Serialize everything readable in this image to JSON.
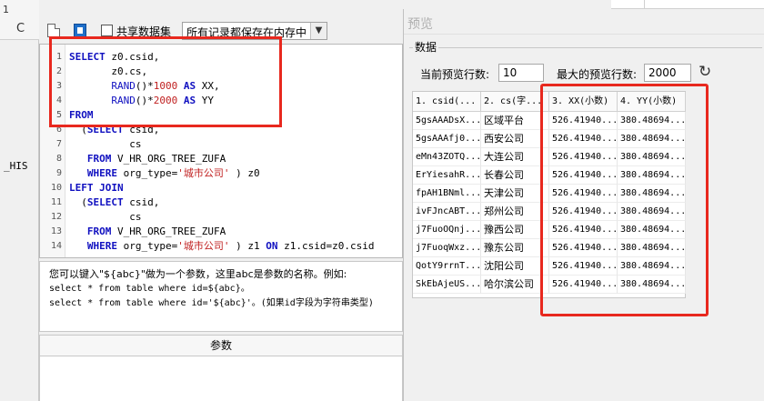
{
  "left_panel": {
    "top_text": "1",
    "side_label": "_HIS",
    "refresh_glyph": "C"
  },
  "toolbar": {
    "share_label": "共享数据集",
    "memory_select_value": "所有记录都保存在内存中",
    "file_icon": "file-icon",
    "db_icon": "database-icon"
  },
  "editor": {
    "lines": [
      {
        "n": "1",
        "segments": [
          {
            "t": "SELECT",
            "c": "kw"
          },
          {
            "t": " z0.csid,",
            "c": ""
          }
        ]
      },
      {
        "n": "2",
        "segments": [
          {
            "t": "       z0.cs,",
            "c": ""
          }
        ]
      },
      {
        "n": "3",
        "segments": [
          {
            "t": "       ",
            "c": ""
          },
          {
            "t": "RAND",
            "c": "fn"
          },
          {
            "t": "()*",
            "c": ""
          },
          {
            "t": "1000",
            "c": "num"
          },
          {
            "t": " ",
            "c": ""
          },
          {
            "t": "AS",
            "c": "kw"
          },
          {
            "t": " XX,",
            "c": ""
          }
        ]
      },
      {
        "n": "4",
        "segments": [
          {
            "t": "       ",
            "c": ""
          },
          {
            "t": "RAND",
            "c": "fn"
          },
          {
            "t": "()*",
            "c": ""
          },
          {
            "t": "2000",
            "c": "num"
          },
          {
            "t": " ",
            "c": ""
          },
          {
            "t": "AS",
            "c": "kw"
          },
          {
            "t": " YY",
            "c": ""
          }
        ]
      },
      {
        "n": "5",
        "segments": [
          {
            "t": "FROM",
            "c": "kw"
          }
        ]
      },
      {
        "n": "6",
        "segments": [
          {
            "t": "  (",
            "c": ""
          },
          {
            "t": "SELECT",
            "c": "kw"
          },
          {
            "t": " csid,",
            "c": ""
          }
        ]
      },
      {
        "n": "7",
        "segments": [
          {
            "t": "          cs",
            "c": ""
          }
        ]
      },
      {
        "n": "8",
        "segments": [
          {
            "t": "   ",
            "c": ""
          },
          {
            "t": "FROM",
            "c": "kw"
          },
          {
            "t": " V_HR_ORG_TREE_ZUFA",
            "c": ""
          }
        ]
      },
      {
        "n": "9",
        "segments": [
          {
            "t": "   ",
            "c": ""
          },
          {
            "t": "WHERE",
            "c": "kw"
          },
          {
            "t": " org_type=",
            "c": ""
          },
          {
            "t": "'城市公司'",
            "c": "str"
          },
          {
            "t": " ) z0",
            "c": ""
          }
        ]
      },
      {
        "n": "10",
        "segments": [
          {
            "t": "LEFT JOIN",
            "c": "kw"
          }
        ]
      },
      {
        "n": "11",
        "segments": [
          {
            "t": "  (",
            "c": ""
          },
          {
            "t": "SELECT",
            "c": "kw"
          },
          {
            "t": " csid,",
            "c": ""
          }
        ]
      },
      {
        "n": "12",
        "segments": [
          {
            "t": "          cs",
            "c": ""
          }
        ]
      },
      {
        "n": "13",
        "segments": [
          {
            "t": "   ",
            "c": ""
          },
          {
            "t": "FROM",
            "c": "kw"
          },
          {
            "t": " V_HR_ORG_TREE_ZUFA",
            "c": ""
          }
        ]
      },
      {
        "n": "14",
        "segments": [
          {
            "t": "   ",
            "c": ""
          },
          {
            "t": "WHERE",
            "c": "kw"
          },
          {
            "t": " org_type=",
            "c": ""
          },
          {
            "t": "'城市公司'",
            "c": "str"
          },
          {
            "t": " ) z1 ",
            "c": ""
          },
          {
            "t": "ON",
            "c": "kw"
          },
          {
            "t": " z1.csid=z0.csid",
            "c": ""
          }
        ]
      }
    ]
  },
  "hint": {
    "line1": "您可以键入\"${abc}\"做为一个参数，这里abc是参数的名称。例如:",
    "line2": "select * from table where id=${abc}。",
    "line3": "select * from table where id='${abc}'。(如果id字段为字符串类型)"
  },
  "params": {
    "header": "参数"
  },
  "preview": {
    "title": "预览",
    "group_label": "数据",
    "current_rows_label": "当前预览行数:",
    "current_rows_value": "10",
    "max_rows_label": "最大的预览行数:",
    "max_rows_value": "2000",
    "refresh_icon": "refresh-icon",
    "columns": [
      "1. csid(...",
      "2. cs(字...",
      "3. XX(小数)",
      "4. YY(小数)"
    ],
    "rows": [
      [
        "5gsAAADsX...",
        "区域平台",
        "526.41940...",
        "380.48694..."
      ],
      [
        "5gsAAAfj0...",
        "西安公司",
        "526.41940...",
        "380.48694..."
      ],
      [
        "eMn43ZOTQ...",
        "大连公司",
        "526.41940...",
        "380.48694..."
      ],
      [
        "ErYiesahR...",
        "长春公司",
        "526.41940...",
        "380.48694..."
      ],
      [
        "fpAH1BNml...",
        "天津公司",
        "526.41940...",
        "380.48694..."
      ],
      [
        "ivFJncABT...",
        "郑州公司",
        "526.41940...",
        "380.48694..."
      ],
      [
        "j7FuoOQnj...",
        "豫西公司",
        "526.41940...",
        "380.48694..."
      ],
      [
        "j7FuoqWxz...",
        "豫东公司",
        "526.41940...",
        "380.48694..."
      ],
      [
        "QotY9rrnT...",
        "沈阳公司",
        "526.41940...",
        "380.48694..."
      ],
      [
        "SkEbAjeUS...",
        "哈尔滨公司",
        "526.41940...",
        "380.48694..."
      ]
    ]
  }
}
